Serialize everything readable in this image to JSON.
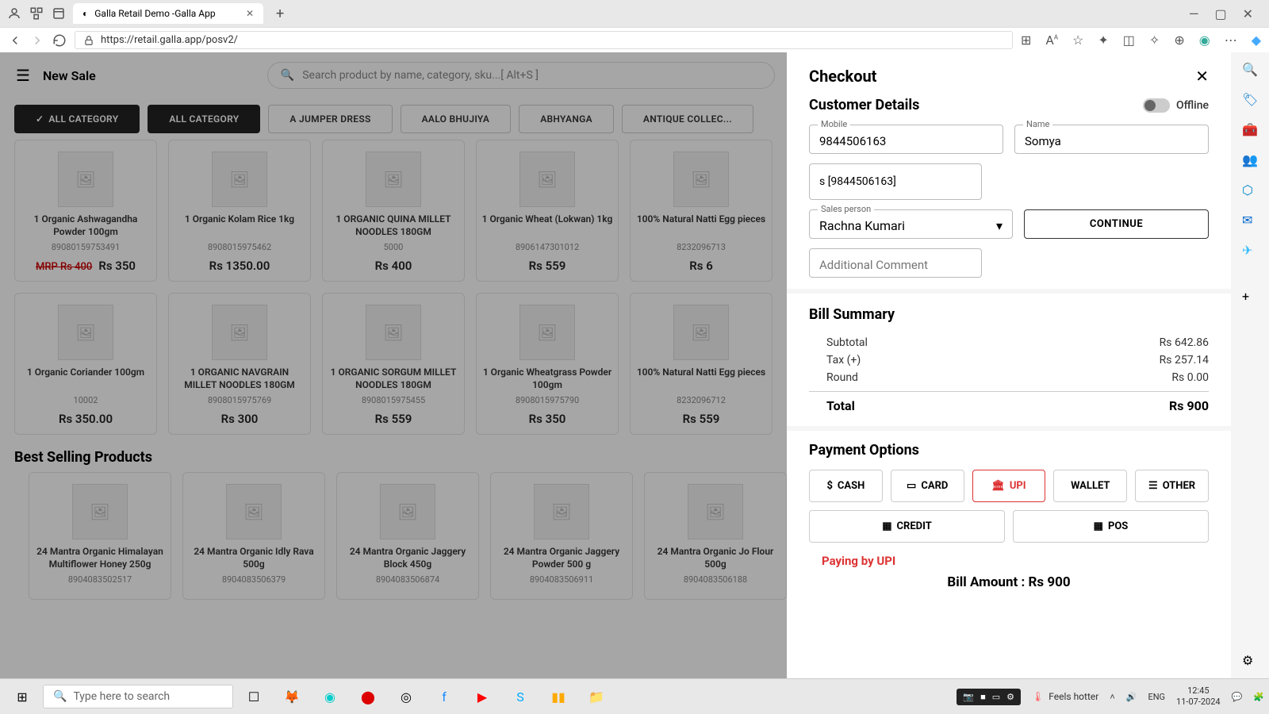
{
  "browser": {
    "tab_title": "Galla Retail Demo -Galla App",
    "url": "https://retail.galla.app/posv2/"
  },
  "pos": {
    "title": "New Sale",
    "search_placeholder": "Search product by name, category, sku...[ Alt+S ]",
    "chips": [
      "ALL CATEGORY",
      "ALL CATEGORY",
      "A JUMPER DRESS",
      "AALO BHUJIYA",
      "ABHYANGA",
      "ANTIQUE COLLEC..."
    ],
    "best_selling_title": "Best Selling Products"
  },
  "products_row1": [
    {
      "name": "1 Organic Ashwagandha Powder 100gm",
      "sku": "89080159753491",
      "mrp": "MRP Rs 400",
      "price": "Rs 350"
    },
    {
      "name": "1 Organic Kolam Rice 1kg",
      "sku": "8908015975462",
      "price": "Rs 1350.00"
    },
    {
      "name": "1 ORGANIC QUINA MILLET NOODLES 180GM",
      "sku": "5000",
      "price": "Rs 400"
    },
    {
      "name": "1 Organic Wheat (Lokwan) 1kg",
      "sku": "8906147301012",
      "price": "Rs 559"
    },
    {
      "name": "100% Natural Natti Egg pieces",
      "sku": "8232096713",
      "price": "Rs 6"
    }
  ],
  "products_row2": [
    {
      "name": "1 Organic Coriander 100gm",
      "sku": "10002",
      "price": "Rs 350.00"
    },
    {
      "name": "1 ORGANIC NAVGRAIN MILLET NOODLES 180GM",
      "sku": "8908015975769",
      "price": "Rs 300"
    },
    {
      "name": "1 ORGANIC SORGUM MILLET NOODLES 180GM",
      "sku": "8908015975455",
      "price": "Rs 559"
    },
    {
      "name": "1 Organic Wheatgrass Powder 100gm",
      "sku": "8908015975790",
      "price": "Rs 350"
    },
    {
      "name": "100% Natural Natti Egg pieces",
      "sku": "8232096712",
      "price": "Rs 559"
    }
  ],
  "best_selling": [
    {
      "name": "24 Mantra Organic Himalayan Multiflower Honey 250g",
      "sku": "8904083502517"
    },
    {
      "name": "24 Mantra Organic Idly Rava 500g",
      "sku": "8904083506379"
    },
    {
      "name": "24 Mantra Organic Jaggery Block 450g",
      "sku": "8904083506874"
    },
    {
      "name": "24 Mantra Organic Jaggery Powder 500 g",
      "sku": "8904083506911"
    },
    {
      "name": "24 Mantra Organic Jo Flour 500g",
      "sku": "8904083506188"
    }
  ],
  "checkout": {
    "title": "Checkout",
    "customer_details_label": "Customer Details",
    "offline_label": "Offline",
    "mobile_label": "Mobile",
    "mobile_value": "9844506163",
    "name_label": "Name",
    "name_value": "Somya",
    "suggest": "s [9844506163]",
    "sales_person_label": "Sales person",
    "sales_person_value": "Rachna Kumari",
    "continue_label": "CONTINUE",
    "comment_placeholder": "Additional Comment",
    "bill_summary_label": "Bill Summary",
    "subtotal_label": "Subtotal",
    "subtotal_value": "Rs 642.86",
    "tax_label": "Tax (+)",
    "tax_value": "Rs 257.14",
    "round_label": "Round",
    "round_value": "Rs 0.00",
    "total_label": "Total",
    "total_value": "Rs 900",
    "payment_options_label": "Payment Options",
    "pay_cash": "CASH",
    "pay_card": "CARD",
    "pay_upi": "UPI",
    "pay_wallet": "WALLET",
    "pay_other": "OTHER",
    "pay_credit": "CREDIT",
    "pay_pos": "POS",
    "paying_by": "Paying by UPI",
    "bill_amount": "Bill Amount : Rs 900"
  },
  "taskbar": {
    "search_placeholder": "Type here to search",
    "weather": "Feels hotter",
    "lang": "ENG",
    "time": "12:45",
    "date": "11-07-2024"
  }
}
